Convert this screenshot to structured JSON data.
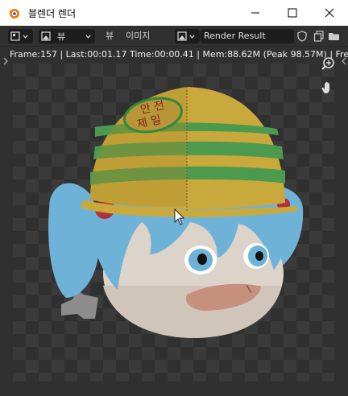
{
  "window": {
    "title": "블렌더 렌더",
    "buttons": [
      "minimize",
      "maximize",
      "close"
    ]
  },
  "toolbar": {
    "editor_type_icon": "image-editor-icon",
    "view_mode_icon": "image-icon",
    "view_mode_label": "뷰",
    "menu_view": "뷰",
    "menu_image": "이미지",
    "image_browse_icon": "image-browse-icon",
    "image_name": "Render Result",
    "right_icons": [
      "shield-icon",
      "copy-icon",
      "folder-icon"
    ]
  },
  "status": {
    "info_line": "Frame:157 | Last:00:01.17 Time:00:00.41 | Mem:88.62M (Peak 98.57M) | Freestyl"
  },
  "helmet_text": "안 전\n제 일",
  "helmet_line1": "안 전",
  "helmet_line2": "제 일",
  "colors": {
    "header_bg": "#303030",
    "field_bg": "#1d1d1d",
    "helmet_yellow": "#c9a93b",
    "helmet_green": "#4c9a4e",
    "hair_blue": "#6fb2d8",
    "skin": "#d9d0c7"
  },
  "viewport_icons": [
    "zoom-icon",
    "hand-pan-icon"
  ]
}
